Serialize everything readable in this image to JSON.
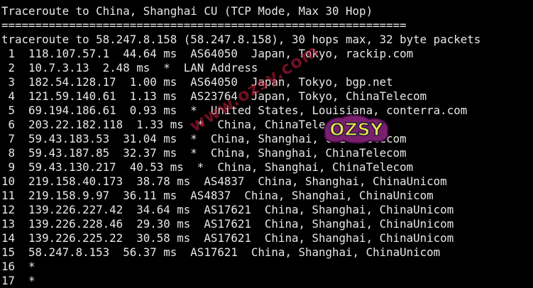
{
  "terminal": {
    "lines": [
      "Traceroute to China, Shanghai CU (TCP Mode, Max 30 Hop)",
      "============================================================",
      "traceroute to 58.247.8.158 (58.247.8.158), 30 hops max, 32 byte packets",
      " 1  118.107.57.1  44.64 ms  AS64050  Japan, Tokyo, rackip.com",
      " 2  10.7.3.13  2.48 ms  *  LAN Address",
      " 3  182.54.128.17  1.00 ms  AS64050  Japan, Tokyo, bgp.net",
      " 4  121.59.140.61  1.13 ms  AS23764  Japan, Tokyo, ChinaTelecom",
      " 5  69.194.186.61  0.93 ms  *  United States, Louisiana, conterra.com",
      " 6  203.22.182.118  1.33 ms  *  China, ChinaTelecom",
      " 7  59.43.183.53  31.04 ms  *  China, Shanghai, ChinaTelecom",
      " 8  59.43.187.85  32.37 ms  *  China, Shanghai, ChinaTelecom",
      " 9  59.43.130.217  40.53 ms  *  China, Shanghai, ChinaTelecom",
      "10  219.158.40.173  38.78 ms  AS4837  China, Shanghai, ChinaUnicom",
      "11  219.158.9.97  36.11 ms  AS4837  China, Shanghai, ChinaUnicom",
      "12  139.226.227.42  34.64 ms  AS17621  China, Shanghai, ChinaUnicom",
      "13  139.226.228.46  29.30 ms  AS17621  China, Shanghai, ChinaUnicom",
      "14  139.226.225.22  30.58 ms  AS17621  China, Shanghai, ChinaUnicom",
      "15  58.247.8.153  56.37 ms  AS17621  China, Shanghai, ChinaUnicom",
      "16  *",
      "17  *"
    ]
  },
  "watermark": {
    "text": "www.ozsy.com",
    "logo_text": "OZSY"
  },
  "colors": {
    "background": "#000000",
    "foreground": "#e8e8e8",
    "watermark": "#c81e3c",
    "logo_fill": "#f2e34a"
  }
}
